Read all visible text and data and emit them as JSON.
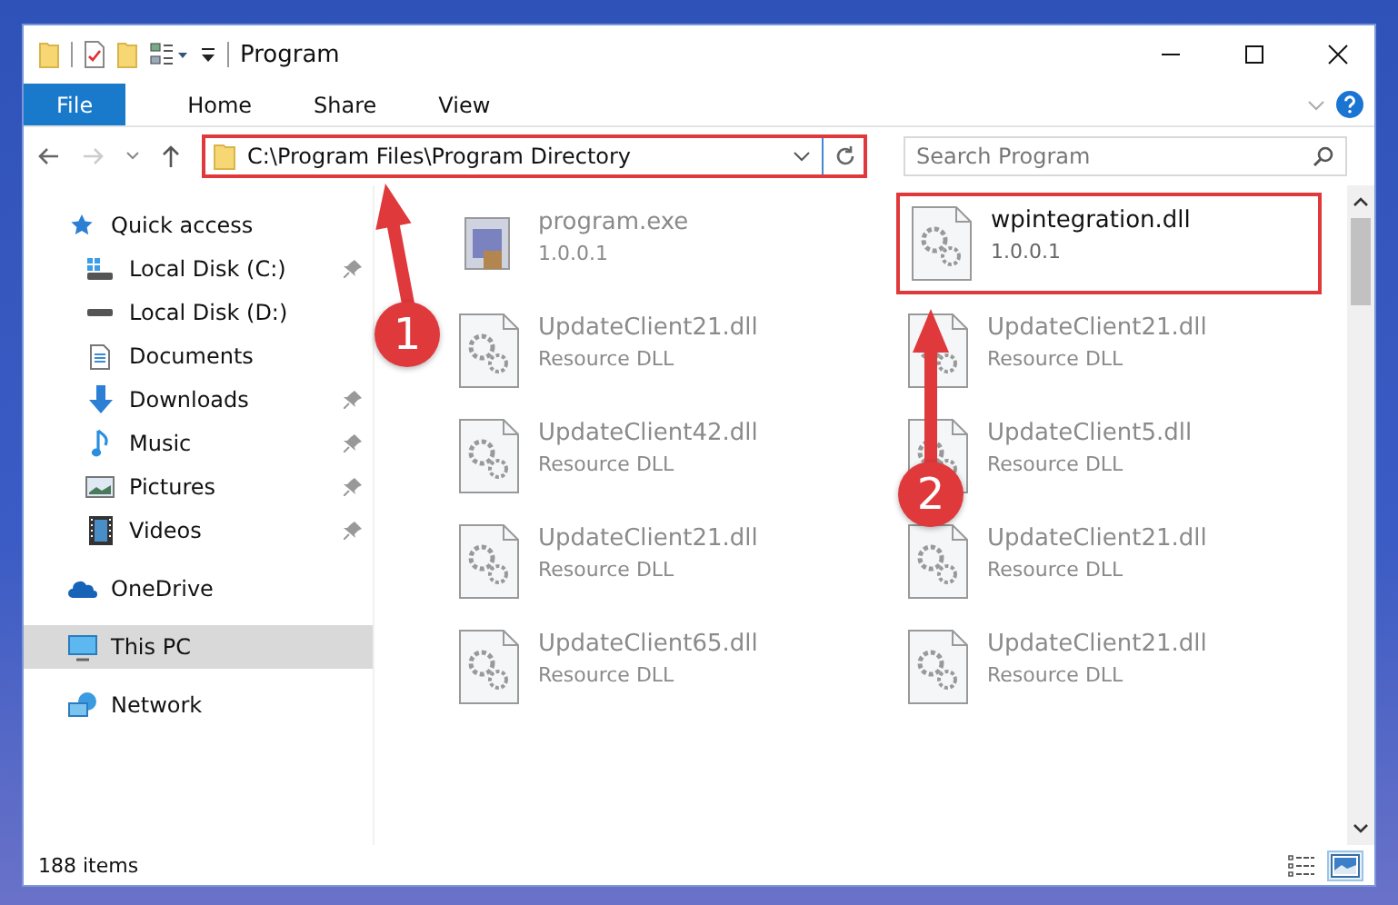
{
  "window": {
    "title": "Program"
  },
  "ribbon_tabs": [
    {
      "label": "File",
      "kind": "file",
      "selected": false
    },
    {
      "label": "Home",
      "kind": "tab",
      "selected": false
    },
    {
      "label": "Share",
      "kind": "tab",
      "selected": false
    },
    {
      "label": "View",
      "kind": "tab",
      "selected": false
    }
  ],
  "navigation": {
    "back_disabled": false,
    "forward_disabled": true
  },
  "address_bar": {
    "path": "C:\\Program Files\\Program Directory",
    "highlighted": true
  },
  "search": {
    "placeholder": "Search Program"
  },
  "sidebar": {
    "items": [
      {
        "label": "Quick access",
        "kind": "section",
        "pinned": false,
        "selected": false
      },
      {
        "label": "Local Disk (C:)",
        "kind": "place",
        "pinned": true,
        "selected": false
      },
      {
        "label": "Local Disk (D:)",
        "kind": "place",
        "pinned": false,
        "selected": false
      },
      {
        "label": "Documents",
        "kind": "place",
        "pinned": false,
        "selected": false
      },
      {
        "label": "Downloads",
        "kind": "place",
        "pinned": true,
        "selected": false
      },
      {
        "label": "Music",
        "kind": "place",
        "pinned": true,
        "selected": false
      },
      {
        "label": "Pictures",
        "kind": "place",
        "pinned": true,
        "selected": false
      },
      {
        "label": "Videos",
        "kind": "place",
        "pinned": true,
        "selected": false
      },
      {
        "label": "OneDrive",
        "kind": "section",
        "pinned": false,
        "selected": false
      },
      {
        "label": "This PC",
        "kind": "section",
        "pinned": false,
        "selected": true
      },
      {
        "label": "Network",
        "kind": "section",
        "pinned": false,
        "selected": false
      }
    ]
  },
  "files": [
    {
      "name": "program.exe",
      "detail": "1.0.0.1",
      "kind": "exe",
      "highlighted": false
    },
    {
      "name": "wpintegration.dll",
      "detail": "1.0.0.1",
      "kind": "dll",
      "highlighted": true
    },
    {
      "name": "UpdateClient21.dll",
      "detail": "Resource DLL",
      "kind": "dll",
      "highlighted": false
    },
    {
      "name": "UpdateClient21.dll",
      "detail": "Resource DLL",
      "kind": "dll",
      "highlighted": false
    },
    {
      "name": "UpdateClient42.dll",
      "detail": "Resource DLL",
      "kind": "dll",
      "highlighted": false
    },
    {
      "name": "UpdateClient5.dll",
      "detail": "Resource DLL",
      "kind": "dll",
      "highlighted": false
    },
    {
      "name": "UpdateClient21.dll",
      "detail": "Resource DLL",
      "kind": "dll",
      "highlighted": false
    },
    {
      "name": "UpdateClient21.dll",
      "detail": "Resource DLL",
      "kind": "dll",
      "highlighted": false
    },
    {
      "name": "UpdateClient65.dll",
      "detail": "Resource DLL",
      "kind": "dll",
      "highlighted": false
    },
    {
      "name": "UpdateClient21.dll",
      "detail": "Resource DLL",
      "kind": "dll",
      "highlighted": false
    }
  ],
  "status_bar": {
    "count": "188 items"
  },
  "view_buttons": [
    {
      "kind": "details",
      "selected": false
    },
    {
      "kind": "large-icons",
      "selected": true
    }
  ],
  "annotations": [
    {
      "number": "1"
    },
    {
      "number": "2"
    }
  ]
}
